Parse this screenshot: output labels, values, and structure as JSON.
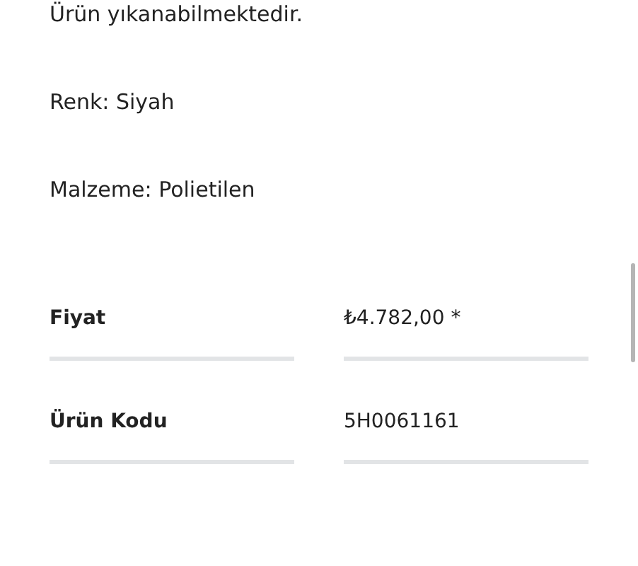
{
  "description": [
    "Ürün yıkanabilmektedir.",
    "Renk: Siyah",
    "Malzeme: Polietilen"
  ],
  "specs": [
    {
      "label": "Fiyat",
      "value": "₺4.782,00 *"
    },
    {
      "label": "Ürün Kodu",
      "value": "5H0061161"
    }
  ]
}
